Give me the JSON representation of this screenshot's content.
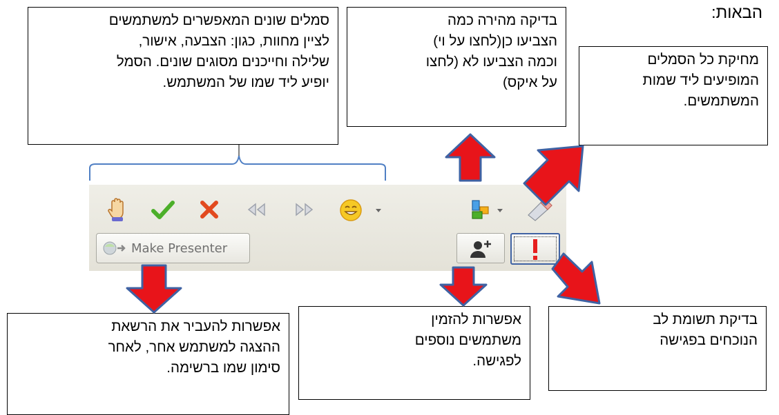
{
  "heading": "הבאות:",
  "callouts": {
    "symbols": "סמלים שונים המאפשרים למשתמשים\nלציין מחוות, כגון: הצבעה, אישור,\nשלילה וחייכנים מסוגים שונים. הסמל\nיופיע ליד שמו של המשתמש.",
    "vote_check": "בדיקה מהירה כמה\nהצביעו כן(לחצו על וי)\nוכמה הצביעו לא (לחצו\nעל איקס)",
    "clear_all": "מחיקת כל הסמלים\nהמופיעים ליד שמות\nהמשתמשים.",
    "make_presenter": "אפשרות להעביר את הרשאת\nההצגה למשתמש אחר, לאחר\nסימון שמו ברשימה.",
    "invite": "אפשרות להזמין\nמשתמשים נוספים\nלפגישה.",
    "attention": "בדיקת תשומת לב\nהנוכחים בפגישה"
  },
  "toolbar": {
    "make_presenter_label": "Make Presenter",
    "icons": [
      "raise-hand",
      "check",
      "cross",
      "slower",
      "faster",
      "smiley",
      "dropdown",
      "vote-results",
      "dropdown",
      "eraser",
      "invite-user",
      "attention"
    ]
  },
  "colors": {
    "arrow_fill": "#e8141a",
    "arrow_stroke": "#3f62a3",
    "brace": "#4f7fc4",
    "check": "#4caf2a",
    "cross": "#e24a1f",
    "smiley": "#f2c21b"
  }
}
